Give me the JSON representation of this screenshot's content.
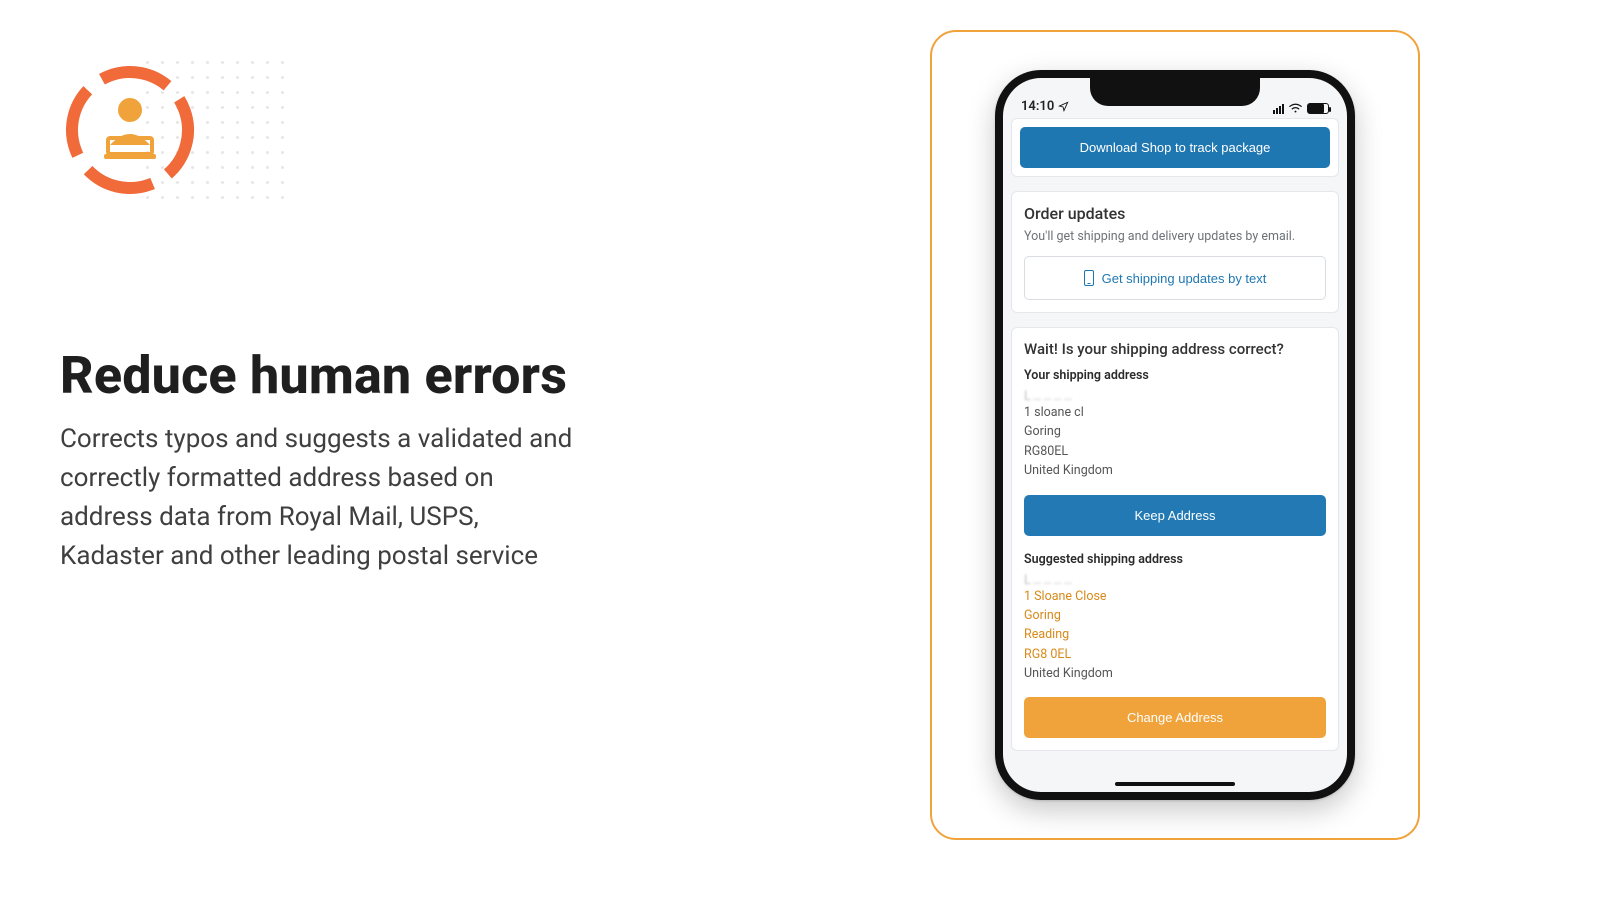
{
  "hero": {
    "headline": "Reduce human errors",
    "body": "Corrects typos and suggests a validated and correctly formatted address based on address data from Royal Mail, USPS, Kadaster and other leading postal service"
  },
  "phone": {
    "status": {
      "time": "14:10"
    },
    "download_button": "Download Shop to track package",
    "order_updates": {
      "title": "Order updates",
      "subtitle": "You'll get shipping and delivery updates by email.",
      "text_button": "Get shipping updates by text"
    },
    "validation": {
      "title": "Wait! Is your shipping address correct?",
      "your_label": "Your shipping address",
      "your_address": {
        "line1": "1 sloane cl",
        "line2": "Goring",
        "line3": "RG80EL",
        "line4": "United Kingdom"
      },
      "keep_button": "Keep Address",
      "suggested_label": "Suggested shipping address",
      "suggested_address": {
        "line1": "1 Sloane Close",
        "line2": "Goring",
        "line3": "Reading",
        "line4": "RG8 0EL",
        "line5": "United Kingdom"
      },
      "change_button": "Change Address"
    }
  },
  "colors": {
    "accent_orange": "#f0a33a",
    "accent_blue": "#1f77b1",
    "icon_orange": "#f06a3a",
    "icon_yellow": "#f0a33a"
  }
}
